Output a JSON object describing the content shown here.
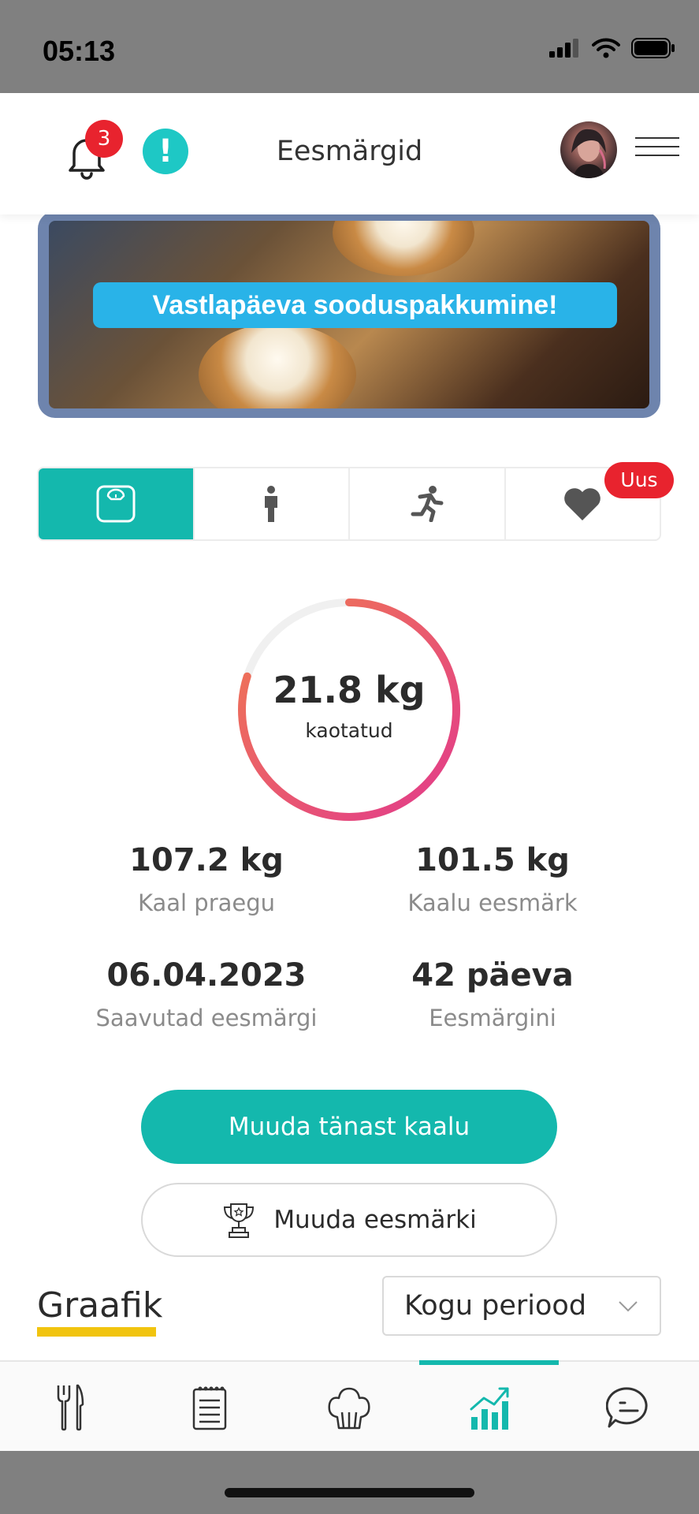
{
  "status_bar": {
    "time": "05:13"
  },
  "header": {
    "title": "Eesmärgid",
    "notification_count": "3",
    "alert_symbol": "!"
  },
  "banner": {
    "text": "Vastlapäeva sooduspakkumine!"
  },
  "tabs": {
    "items": [
      {
        "icon": "scale-icon",
        "active": true
      },
      {
        "icon": "person-icon",
        "active": false
      },
      {
        "icon": "running-icon",
        "active": false
      },
      {
        "icon": "heart-icon",
        "active": false
      }
    ],
    "new_badge": "Uus"
  },
  "progress": {
    "value": "21.8 kg",
    "label": "kaotatud",
    "ring_fraction": 0.8,
    "colors": {
      "start": "#e23a8c",
      "end": "#f07a50",
      "track": "#f0f0f0"
    }
  },
  "stats": {
    "current_weight": {
      "value": "107.2 kg",
      "label": "Kaal praegu"
    },
    "goal_weight": {
      "value": "101.5 kg",
      "label": "Kaalu eesmärk"
    },
    "goal_date": {
      "value": "06.04.2023",
      "label": "Saavutad eesmärgi"
    },
    "days_left": {
      "value": "42 päeva",
      "label": "Eesmärgini"
    }
  },
  "actions": {
    "change_weight": "Muuda tänast kaalu",
    "change_goal": "Muuda eesmärki"
  },
  "graph": {
    "title": "Graafik",
    "period_selected": "Kogu periood"
  },
  "bottom_nav": {
    "items": [
      "cutlery-icon",
      "notepad-icon",
      "chef-hat-icon",
      "chart-icon",
      "chat-icon"
    ],
    "active_index": 3
  },
  "colors": {
    "accent": "#14b8ad",
    "badge": "#e8232e",
    "underline": "#f1c40f"
  }
}
